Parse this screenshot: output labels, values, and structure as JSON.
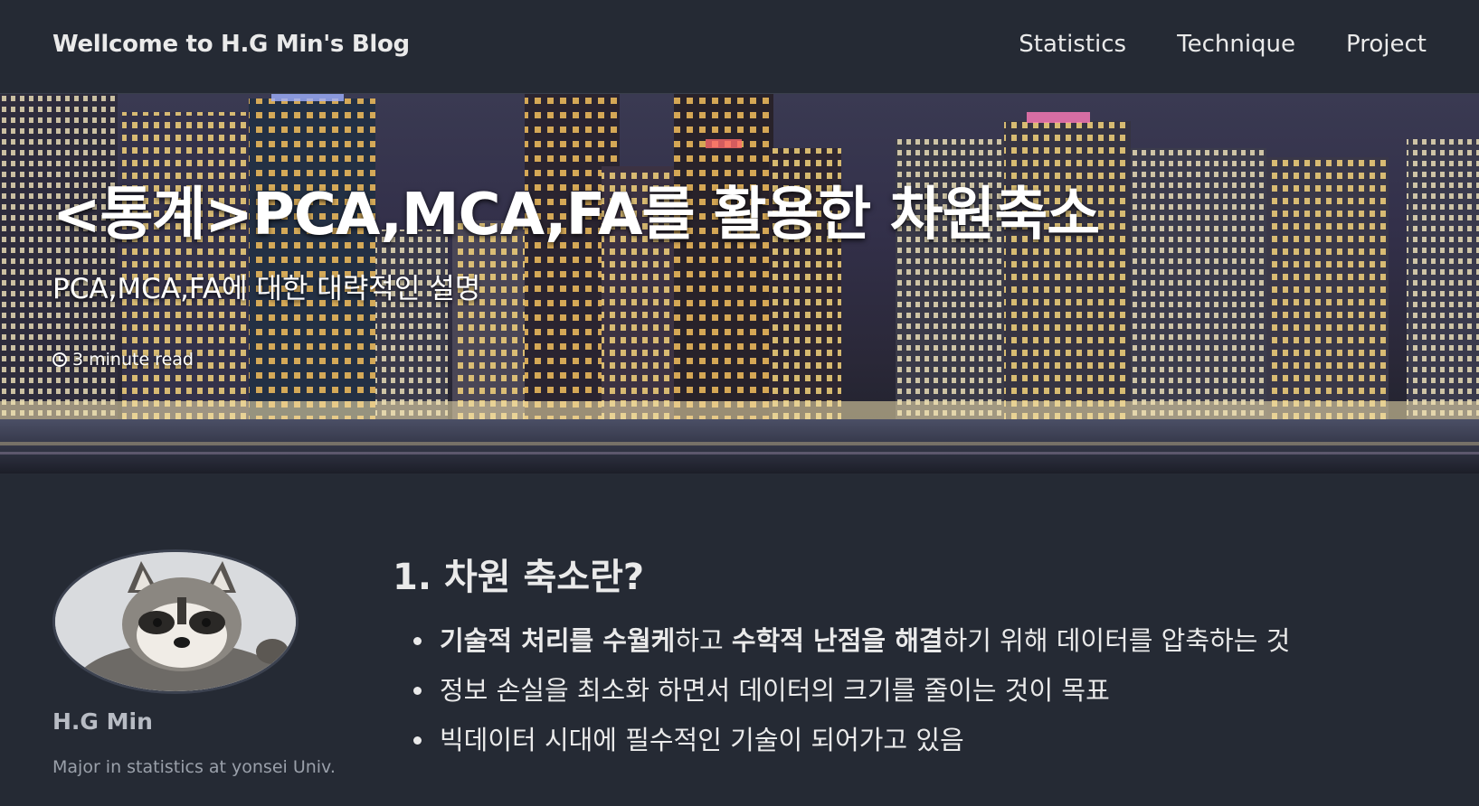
{
  "header": {
    "site_title": "Wellcome to H.G Min's Blog",
    "nav": [
      "Statistics",
      "Technique",
      "Project"
    ]
  },
  "hero": {
    "title": "<통계>PCA,MCA,FA를 활용한 차원축소",
    "subtitle": "PCA,MCA,FA에 대한 대략적인 설명",
    "read_time": "3 minute read",
    "read_time_icon": "clock-icon"
  },
  "sidebar": {
    "avatar_icon": "raccoon-avatar",
    "author_name": "H.G Min",
    "author_bio": "Major in statistics at yonsei Univ."
  },
  "article": {
    "heading": "1. 차원 축소란?",
    "bullets": [
      {
        "bold1": "기술적 처리를 수월케",
        "text1": "하고 ",
        "bold2": "수학적 난점을 해결",
        "text2": "하기 위해 데이터를 압축하는 것"
      },
      {
        "text": "정보 손실을 최소화 하면서 데이터의 크기를 줄이는 것이 목표"
      },
      {
        "text": "빅데이터 시대에 필수적인 기술이 되어가고 있음"
      }
    ]
  },
  "colors": {
    "background": "#252a34",
    "text": "#eaeaea",
    "muted": "#9aa0aa"
  }
}
